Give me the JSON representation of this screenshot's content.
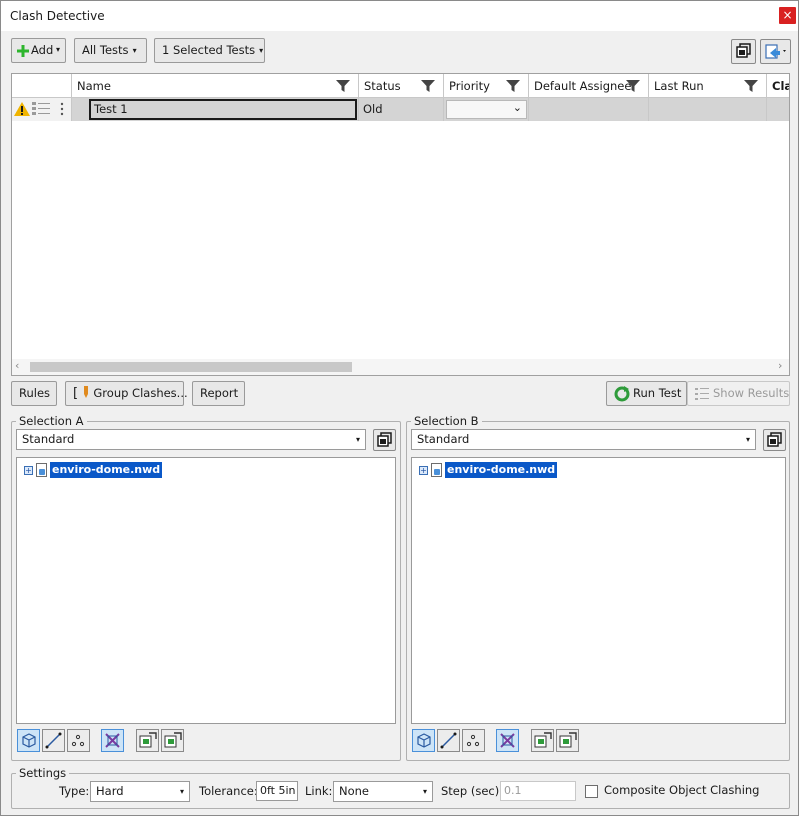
{
  "window": {
    "title": "Clash Detective",
    "close_glyph": "×"
  },
  "toolbar": {
    "add_label": "Add",
    "all_tests_label": "All Tests",
    "selected_tests_label": "1 Selected Tests",
    "caret": "▾"
  },
  "grid": {
    "columns": [
      "Name",
      "Status",
      "Priority",
      "Default Assignee",
      "Last Run",
      "Clas"
    ],
    "rows": [
      {
        "name": "Test 1",
        "status": "Old",
        "priority": "",
        "priority_caret": "⌄",
        "icon": "warning-icon"
      }
    ],
    "scroll_left": "‹",
    "scroll_right": "›"
  },
  "actions": {
    "rules_label": "Rules",
    "group_clashes_label": "Group Clashes...",
    "group_bracket": "[",
    "report_label": "Report",
    "run_test_label": "Run Test",
    "show_results_label": "Show Results"
  },
  "selection_a": {
    "label": "Selection A",
    "mode": "Standard",
    "tree_item": "enviro-dome.nwd"
  },
  "selection_b": {
    "label": "Selection B",
    "mode": "Standard",
    "tree_item": "enviro-dome.nwd"
  },
  "settings": {
    "label": "Settings",
    "type_label": "Type:",
    "type_value": "Hard",
    "tolerance_label": "Tolerance:",
    "tolerance_value": "0ft 5in",
    "link_label": "Link:",
    "link_value": "None",
    "step_label": "Step (sec):",
    "step_value": "0.1",
    "composite_label": "Composite Object Clashing"
  },
  "colors": {
    "accent": "#0a58c8",
    "close": "#d92121",
    "warning": "#f0b400",
    "add_green": "#2db52d",
    "run_green": "#2e9b3a"
  }
}
